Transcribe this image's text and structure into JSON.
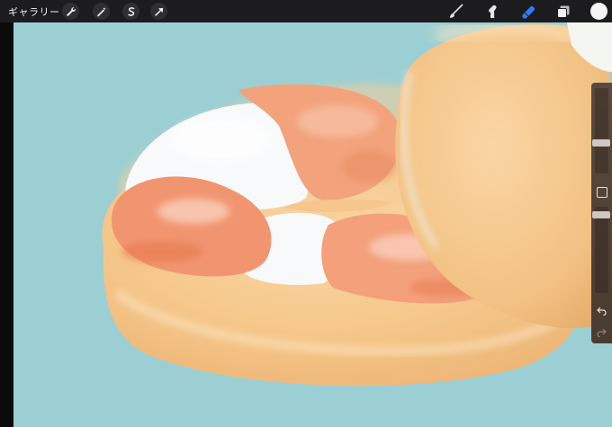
{
  "toolbar": {
    "gallery_label": "ギャラリー",
    "left_tools": [
      "wrench-icon",
      "magic-wand-icon",
      "selection-icon",
      "transform-arrow-icon"
    ],
    "right_tools": [
      "brush-icon",
      "smudge-icon",
      "eraser-icon",
      "layers-icon"
    ],
    "active_tool": "eraser",
    "current_color": "#f5f5f5"
  },
  "sidebar": {
    "brush_size_level": 0.25,
    "brush_opacity_level": 0.55,
    "icons": [
      "modify-button",
      "undo-icon",
      "redo-icon"
    ]
  },
  "canvas": {
    "background_color": "#9ccfd3",
    "subject": "painting"
  },
  "colors": {
    "toolbar_bg": "#1c1c1e",
    "active_tool_blue": "#2f7bff",
    "sidebar_bg": "#54453a"
  }
}
